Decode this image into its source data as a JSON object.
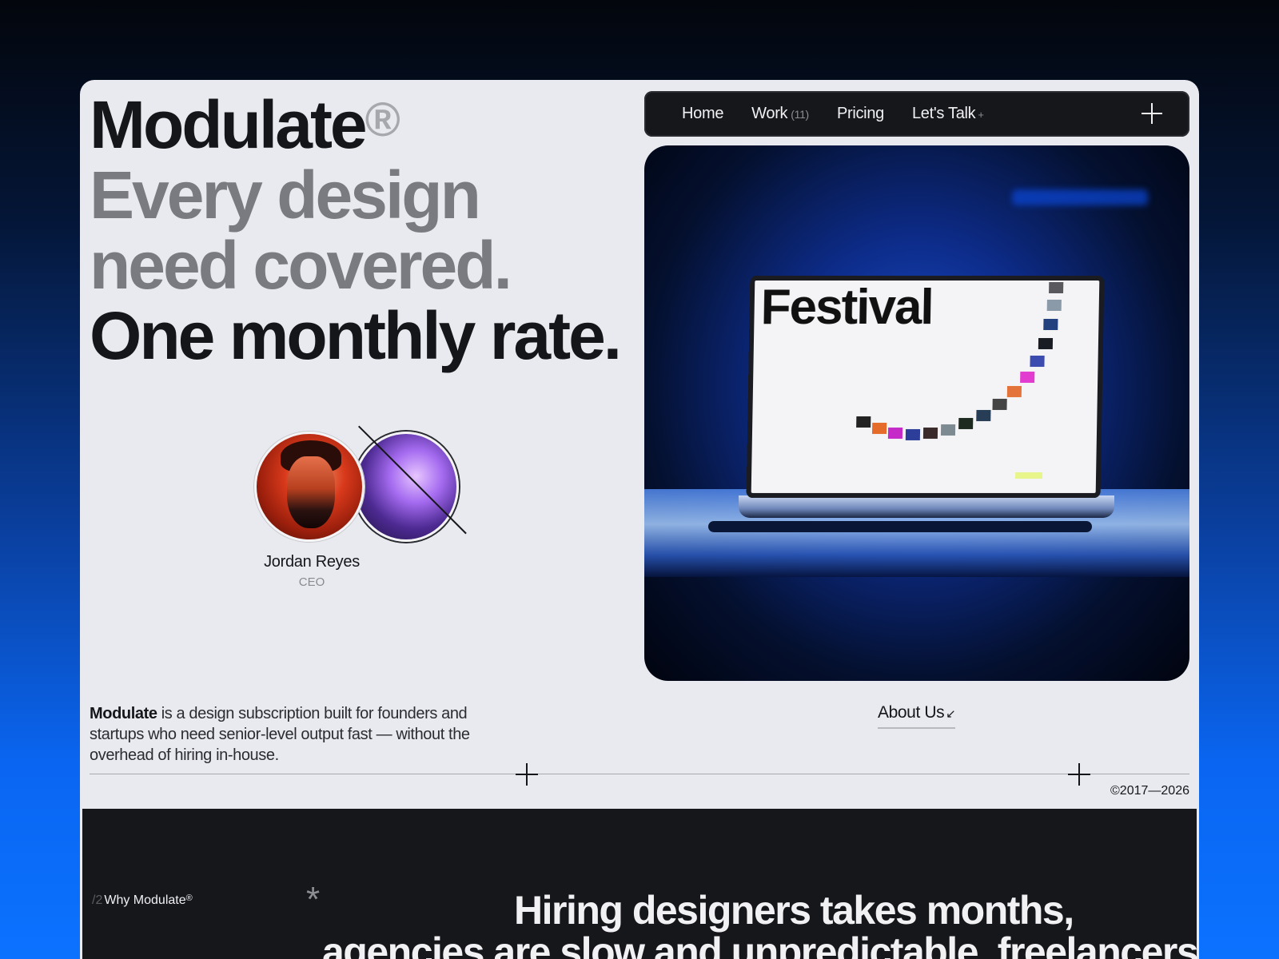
{
  "hero": {
    "brand": "Modulate",
    "brand_mark": "®",
    "line2": "Every design",
    "line3": "need covered.",
    "line4": "One monthly rate."
  },
  "nav": {
    "items": [
      {
        "label": "Home"
      },
      {
        "label": "Work",
        "count": "(11)"
      },
      {
        "label": "Pricing"
      },
      {
        "label": "Let's Talk",
        "suffix": "+"
      }
    ],
    "menu_icon": "plus-icon"
  },
  "showcase": {
    "screen_title": "Festival"
  },
  "profile": {
    "name": "Jordan Reyes",
    "role": "CEO"
  },
  "intro": {
    "brand": "Modulate",
    "text": " is a design subscription built for founders and startups who need senior-level output fast — without the overhead of hiring in-house."
  },
  "about_link": {
    "label": "About Us",
    "icon": "arrow-down-left-icon"
  },
  "copyright": "©2017—2026",
  "why_section": {
    "index": "/2",
    "label": "Why Modulate",
    "label_mark": "®",
    "headline_line1": "Hiring designers takes months,",
    "headline_line2": "agencies are slow and unpredictable, freelancers"
  },
  "colors": {
    "accent_blue": "#0b72ff",
    "card_bg": "#e9eaef",
    "dark": "#16171b"
  }
}
